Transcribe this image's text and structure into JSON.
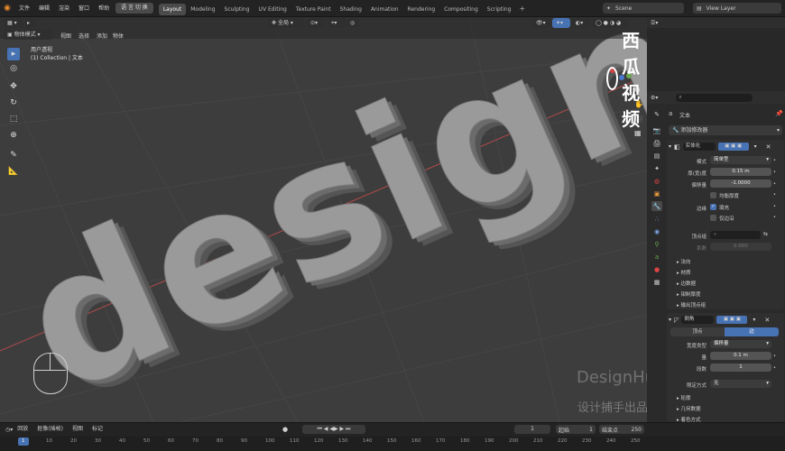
{
  "menubar": {
    "items": [
      "文件",
      "编辑",
      "渲染",
      "窗口",
      "帮助"
    ],
    "lang_button": "语 言 切 换",
    "workspaces": [
      "Layout",
      "Modeling",
      "Sculpting",
      "UV Editing",
      "Texture Paint",
      "Shading",
      "Animation",
      "Rendering",
      "Compositing",
      "Scripting"
    ],
    "active_workspace": "Layout",
    "scene": "Scene",
    "view_layer": "View Layer"
  },
  "viewport": {
    "mode": "物体模式",
    "menu": [
      "视图",
      "选择",
      "添加",
      "物体"
    ],
    "transform": "全局",
    "overlay_title": "用户透视",
    "overlay_sub": "(1) Collection | 文本",
    "text_3d": "design",
    "watermark_title": "DesignHunting",
    "watermark_sub": "设计捕手出品-基础部分",
    "logo_text": "西瓜视频"
  },
  "properties": {
    "object_name": "文本",
    "add_modifier": "添加修改器",
    "mod1": {
      "name": "实体化",
      "mode_label": "模式",
      "mode_value": "简单型",
      "thickness_label": "厚(宽)度",
      "thickness_value": "0.15 m",
      "offset_label": "偏移量",
      "offset_value": "-1.0000",
      "even_label": "均衡厚度",
      "rim_label": "边缘",
      "fill_label": "填充",
      "only_rim_label": "仅边沿",
      "vgroup_label": "顶点组",
      "factor_label": "系数",
      "factor_value": "0.000",
      "sections": [
        "法向",
        "材质",
        "边数据",
        "钳制厚度",
        "输出顶点组"
      ]
    },
    "mod2": {
      "name": "倒角",
      "tab_vertex": "顶点",
      "tab_edge": "边",
      "width_type_label": "宽度类型",
      "width_type_value": "偏移量",
      "amount_label": "量",
      "amount_value": "0.1 m",
      "segments_label": "段数",
      "segments_value": "1",
      "limit_label": "限定方式",
      "limit_value": "无",
      "sections": [
        "轮廓",
        "几何数据",
        "着色方式"
      ]
    }
  },
  "timeline": {
    "menu": [
      "回放",
      "抠像(插帧)",
      "视图",
      "标记"
    ],
    "current_frame": "1",
    "start_label": "起始",
    "start_value": "1",
    "end_label": "结束点",
    "end_value": "250",
    "ruler": [
      "1",
      "10",
      "20",
      "30",
      "40",
      "50",
      "60",
      "70",
      "80",
      "90",
      "100",
      "110",
      "120",
      "130",
      "140",
      "150",
      "160",
      "170",
      "180",
      "190",
      "200",
      "210",
      "220",
      "230",
      "240",
      "250"
    ]
  },
  "colors": {
    "accent": "#4772b3",
    "x_axis": "#b04a4a",
    "bg_viewport": "#3d3d3d"
  }
}
